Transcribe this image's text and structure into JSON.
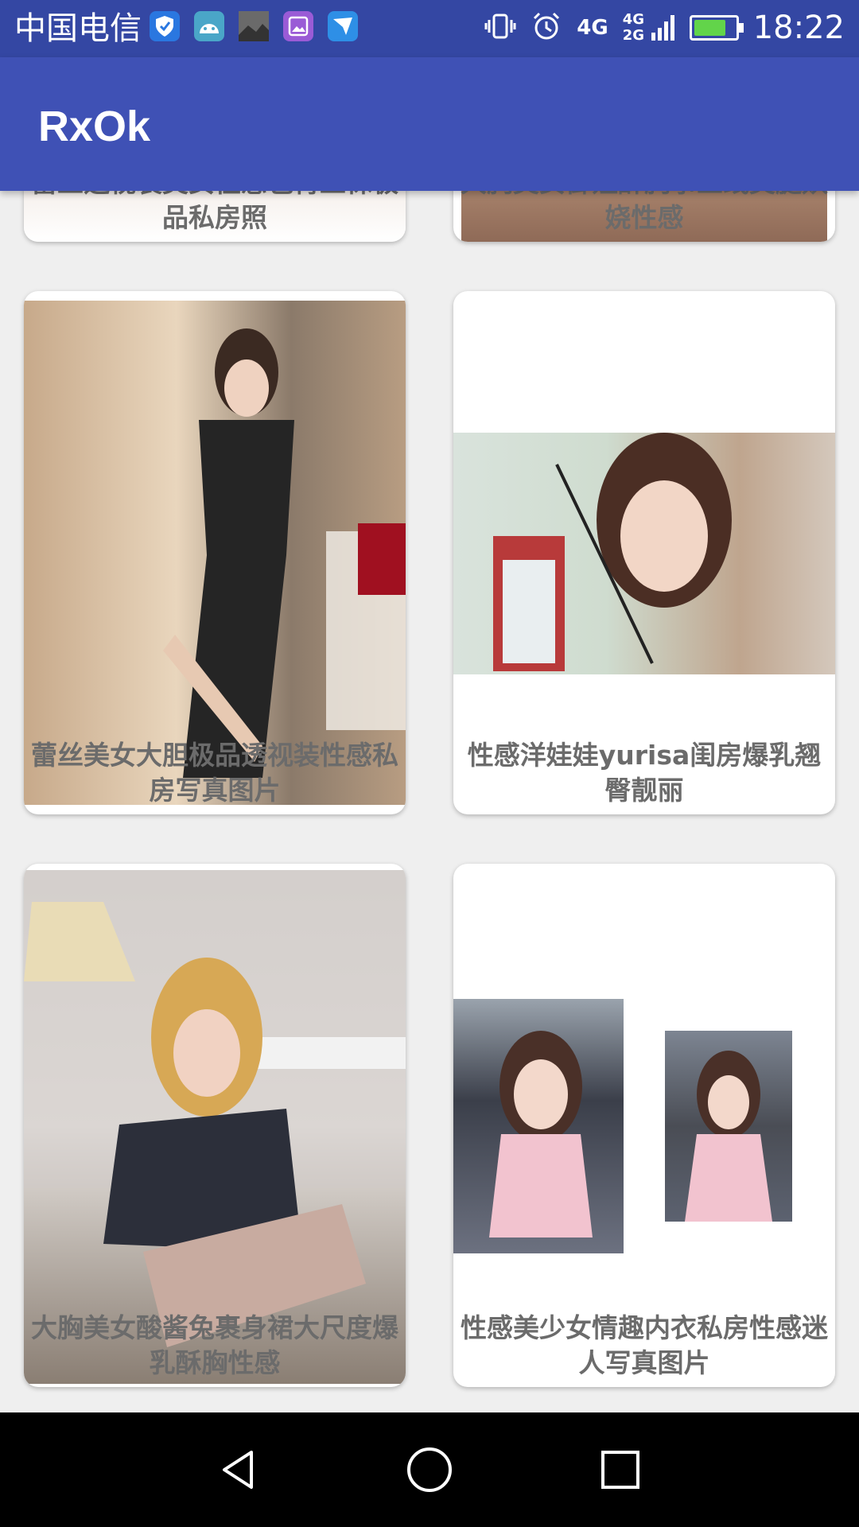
{
  "status_bar": {
    "carrier": "中国电信",
    "network_top": "4G",
    "network_bottom": "4G 2G",
    "time": "18:22",
    "battery_level": 0.9,
    "notification_icons": [
      "shield-icon",
      "android-icon",
      "photo-thumbnail-icon",
      "gallery-icon",
      "bird-icon"
    ]
  },
  "app_bar": {
    "title": "RxOk"
  },
  "feed": [
    {
      "caption": "蕾丝透视装美女性感包臀丝袜极品私房照"
    },
    {
      "caption": "大胸美女御姐酥胸事业线美腿妖娆性感"
    },
    {
      "caption": "蕾丝美女大胆极品透视装性感私房写真图片"
    },
    {
      "caption": "性感洋娃娃yurisa闺房爆乳翘臀靓丽"
    },
    {
      "caption": "大胸美女酸酱兔裹身裙大尺度爆乳酥胸性感"
    },
    {
      "caption": "性感美少女情趣内衣私房性感迷人写真图片"
    }
  ],
  "colors": {
    "status_bar": "#3447a3",
    "app_bar": "#3f51b5",
    "caption": "#6b6b6b",
    "background": "#efefef"
  }
}
